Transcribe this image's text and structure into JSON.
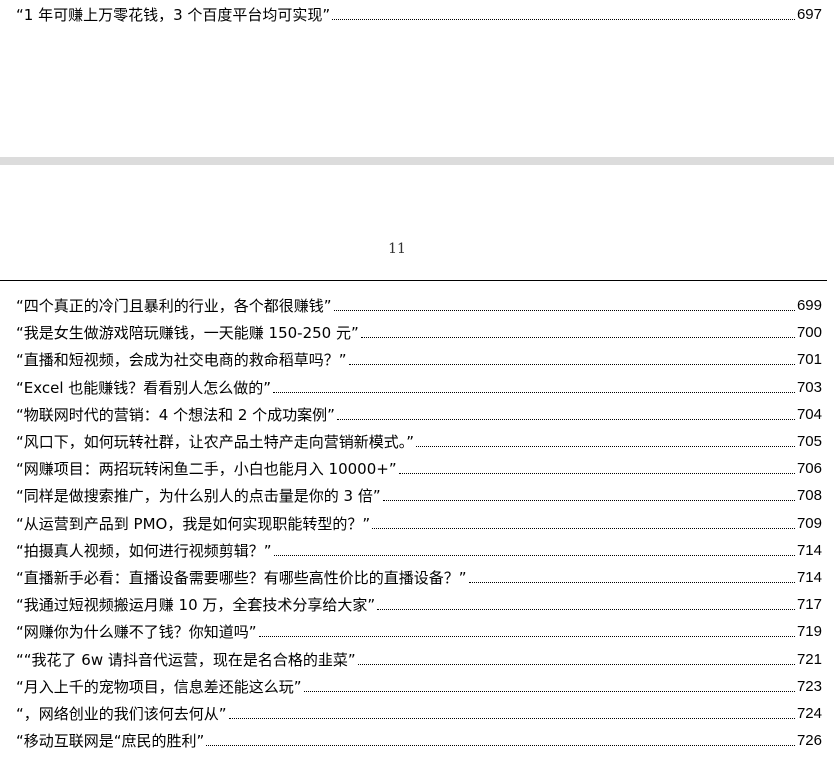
{
  "top_entry": {
    "title": "“1 年可赚上万零花钱，3 个百度平台均可实现”",
    "page": "697"
  },
  "page_number": "11",
  "toc_entries": [
    {
      "title": "“四个真正的冷门且暴利的行业，各个都很赚钱”",
      "page": "699"
    },
    {
      "title": "“我是女生做游戏陪玩赚钱，一天能赚 150-250 元”",
      "page": "700"
    },
    {
      "title": "“直播和短视频，会成为社交电商的救命稻草吗？”",
      "page": "701"
    },
    {
      "title": "“Excel 也能赚钱？看看别人怎么做的”",
      "page": "703"
    },
    {
      "title": "“物联网时代的营销：4 个想法和 2 个成功案例”",
      "page": "704"
    },
    {
      "title": "“风口下，如何玩转社群，让农产品土特产走向营销新模式。”",
      "page": "705"
    },
    {
      "title": "“网赚项目：两招玩转闲鱼二手，小白也能月入 10000+”",
      "page": "706"
    },
    {
      "title": "“同样是做搜索推广，为什么别人的点击量是你的 3 倍”",
      "page": "708"
    },
    {
      "title": "“从运营到产品到 PMO，我是如何实现职能转型的？”",
      "page": "709"
    },
    {
      "title": "“拍摄真人视频，如何进行视频剪辑？”",
      "page": "714"
    },
    {
      "title": "“直播新手必看：直播设备需要哪些？有哪些高性价比的直播设备？”",
      "page": "714"
    },
    {
      "title": "“我通过短视频搬运月赚 10 万，全套技术分享给大家”",
      "page": "717"
    },
    {
      "title": "“网赚你为什么赚不了钱？你知道吗”",
      "page": "719"
    },
    {
      "title": "““我花了 6w 请抖音代运营，现在是名合格的韭菜”",
      "page": "721"
    },
    {
      "title": "“月入上千的宠物项目，信息差还能这么玩”",
      "page": "723"
    },
    {
      "title": "“，网络创业的我们该何去何从”",
      "page": "724"
    },
    {
      "title": "“移动互联网是“庶民的胜利”",
      "page": "726"
    }
  ]
}
